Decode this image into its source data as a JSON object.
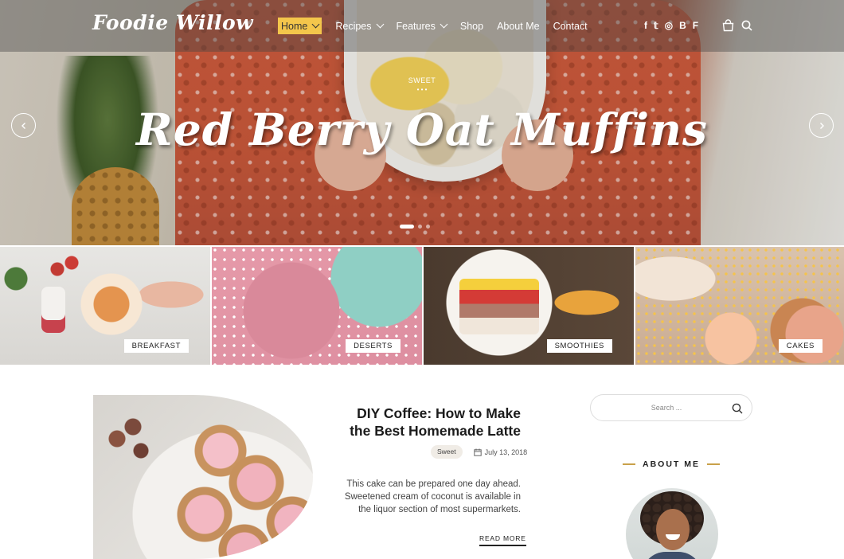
{
  "header": {
    "logo": "Foodie Willow",
    "nav": [
      {
        "label": "Home",
        "dropdown": true,
        "active": true
      },
      {
        "label": "Recipes",
        "dropdown": true
      },
      {
        "label": "Features",
        "dropdown": true
      },
      {
        "label": "Shop",
        "dropdown": false
      },
      {
        "label": "About Me",
        "dropdown": false
      },
      {
        "label": "Contact",
        "dropdown": false
      }
    ],
    "social": [
      "facebook-icon",
      "twitter-icon",
      "instagram-icon",
      "bloglovin-icon",
      "foursquare-icon"
    ],
    "social_glyphs": [
      "f",
      "𝕥",
      "◎",
      "B",
      "F"
    ]
  },
  "hero": {
    "category": "SWEET",
    "dots": "• • •",
    "title": "Red Berry Oat Muffins",
    "accent_color": "#f4c64b"
  },
  "categories": [
    {
      "label": "BREAKFAST"
    },
    {
      "label": "DESERTS"
    },
    {
      "label": "SMOOTHIES"
    },
    {
      "label": "CAKES"
    }
  ],
  "post": {
    "title": "DIY Coffee: How to Make the Best Homemade Latte",
    "tag": "Sweet",
    "date": "July 13, 2018",
    "excerpt": "This cake can be prepared one day ahead. Sweetened cream of coconut is available in the liquor section of most supermarkets.",
    "read_more": "READ MORE"
  },
  "sidebar": {
    "search_placeholder": "Search ...",
    "about_heading": "ABOUT ME"
  }
}
